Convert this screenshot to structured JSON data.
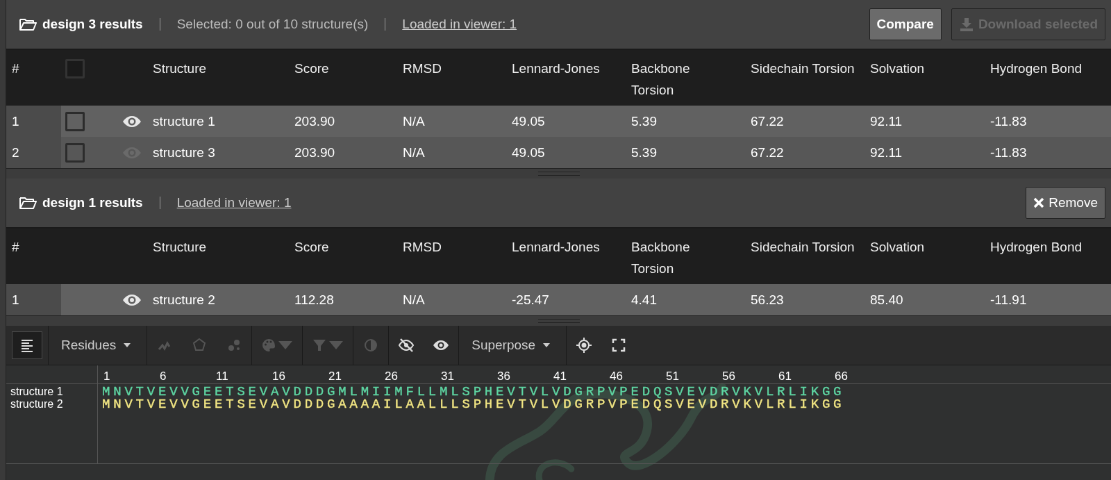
{
  "panels": [
    {
      "title": "design 3 results",
      "selected_text": "Selected: 0 out of 10 structure(s)",
      "loaded_link": "Loaded in viewer: 1",
      "buttons": [
        {
          "label": "Compare",
          "kind": "compare",
          "disabled": false
        },
        {
          "label": "Download selected",
          "kind": "download",
          "disabled": true
        }
      ],
      "select_all": {
        "checked": false
      },
      "columns": [
        "#",
        "Structure",
        "Score",
        "RMSD",
        "Lennard-Jones",
        "Backbone Torsion",
        "Sidechain Torsion",
        "Solvation",
        "Hydrogen Bond"
      ],
      "rows": [
        {
          "index": "1",
          "checked": false,
          "visible": true,
          "structure": "structure 1",
          "values": [
            "203.90",
            "N/A",
            "49.05",
            "5.39",
            "67.22",
            "92.11",
            "-11.83"
          ]
        },
        {
          "index": "2",
          "checked": false,
          "visible": false,
          "structure": "structure 3",
          "values": [
            "203.90",
            "N/A",
            "49.05",
            "5.39",
            "67.22",
            "92.11",
            "-11.83"
          ]
        }
      ]
    },
    {
      "title": "design 1 results",
      "loaded_link": "Loaded in viewer: 1",
      "buttons": [
        {
          "label": "Remove",
          "kind": "remove",
          "disabled": false
        }
      ],
      "columns": [
        "#",
        "Structure",
        "Score",
        "RMSD",
        "Lennard-Jones",
        "Backbone Torsion",
        "Sidechain Torsion",
        "Solvation",
        "Hydrogen Bond"
      ],
      "rows": [
        {
          "index": "1",
          "visible": true,
          "structure": "structure 2",
          "values": [
            "112.28",
            "N/A",
            "-25.47",
            "4.41",
            "56.23",
            "85.40",
            "-11.91"
          ]
        }
      ]
    }
  ],
  "toolbar": [
    {
      "kind": "list",
      "selected": true,
      "disabled": false
    },
    {
      "kind": "dropdown",
      "label": "Residues",
      "disabled": false
    },
    {
      "kind": "zigzag",
      "disabled": true
    },
    {
      "kind": "polygon",
      "disabled": true
    },
    {
      "kind": "dots",
      "disabled": true
    },
    {
      "kind": "palette",
      "disabled": true
    },
    {
      "kind": "filter",
      "disabled": true
    },
    {
      "kind": "contrast",
      "disabled": true
    },
    {
      "kind": "eye-off",
      "disabled": false
    },
    {
      "kind": "eye",
      "disabled": false
    },
    {
      "kind": "dropdown",
      "label": "Superpose",
      "disabled": false
    },
    {
      "kind": "target",
      "disabled": false
    },
    {
      "kind": "fullscreen",
      "disabled": false
    }
  ],
  "sequence_viewer": {
    "ruler": [
      "1",
      "6",
      "11",
      "16",
      "21",
      "26",
      "31",
      "36",
      "41",
      "46",
      "51",
      "56",
      "61",
      "66"
    ],
    "tracks": [
      {
        "name": "structure 1",
        "color": "#5ed6a3",
        "sequence": "MNVTVEVVGEETSEVAVDDDGMLMIIMFLLMLSPHEVTVLVDGRPVPEDQSVEVDRVKVLRLIKGG"
      },
      {
        "name": "structure 2",
        "color": "#f2e683",
        "sequence": "MNVTVEVVGEETSEVAVDDDGAAAAILAALLLSPHEVTVLVDGRPVPEDQSVEVDRVKVLRLIKGG"
      }
    ]
  }
}
